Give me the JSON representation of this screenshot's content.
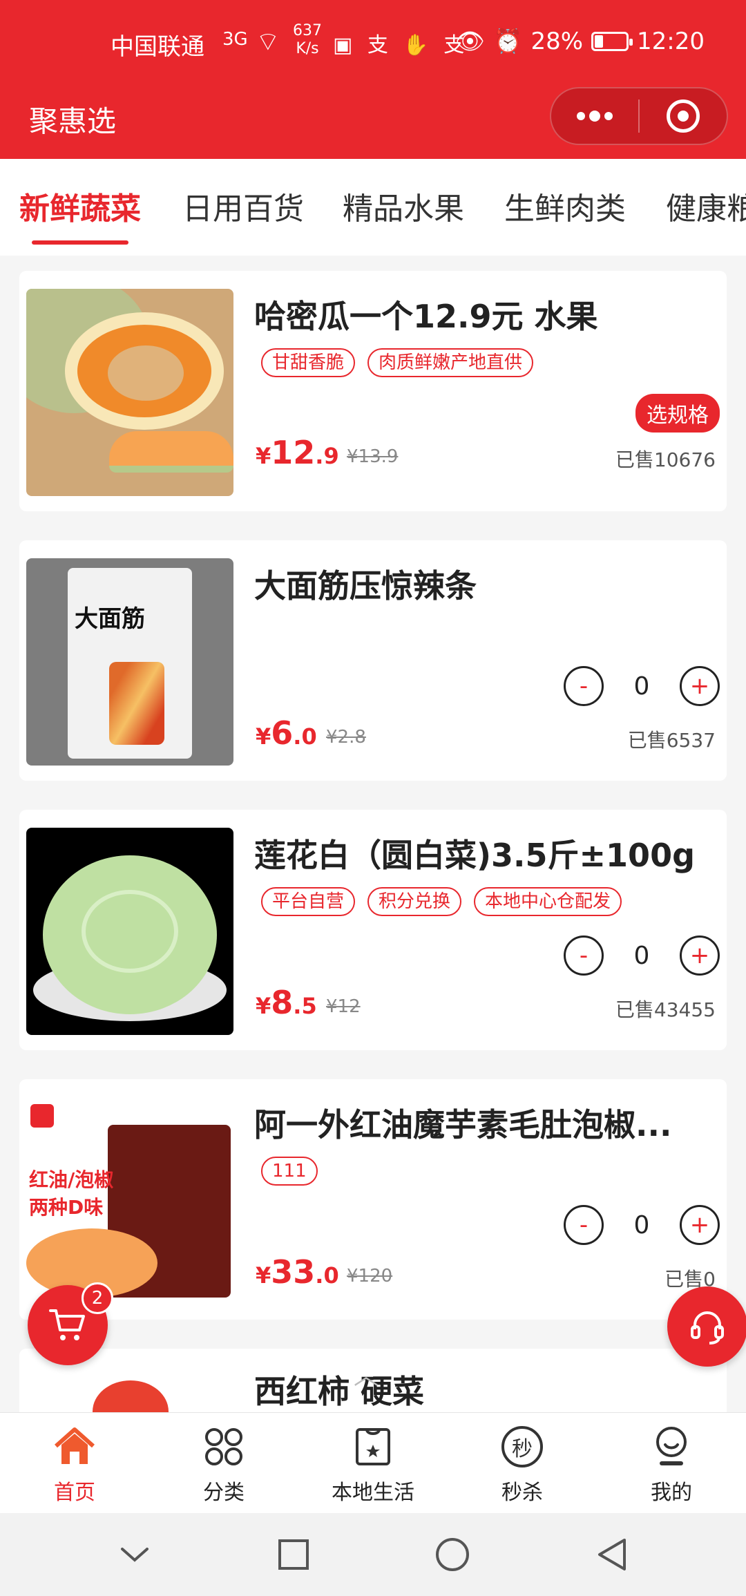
{
  "status_bar": {
    "carrier": "中国联通",
    "signal": "3G",
    "net_speed_value": "637",
    "net_speed_unit": "K/s",
    "battery": "28%",
    "battery_level": 0.28,
    "time": "12:20"
  },
  "header": {
    "title": "聚惠选",
    "menu_icon": "more-dots-icon",
    "close_icon": "target-close-icon"
  },
  "tabs": [
    {
      "label": "新鲜蔬菜",
      "active": true
    },
    {
      "label": "日用百货"
    },
    {
      "label": "精品水果"
    },
    {
      "label": "生鲜肉类"
    },
    {
      "label": "健康粮"
    }
  ],
  "products": [
    {
      "name": "哈密瓜一个12.9元 水果",
      "tags": [
        "甘甜香脆",
        "肉质鲜嫩产地直供"
      ],
      "price_symbol": "¥",
      "price_int": "12",
      "price_dec": ".9",
      "original_price": "¥13.9",
      "sold": "已售10676",
      "spec_button": "选规格"
    },
    {
      "name": "大面筋压惊辣条",
      "tags": [],
      "price_symbol": "¥",
      "price_int": "6",
      "price_dec": ".0",
      "original_price": "¥2.8",
      "sold": "已售6537",
      "qty": "0",
      "thumb_text": "大面筋"
    },
    {
      "name": "莲花白（圆白菜)3.5斤±100g",
      "tags": [
        "平台自营",
        "积分兑换",
        "本地中心仓配发"
      ],
      "price_symbol": "¥",
      "price_int": "8",
      "price_dec": ".5",
      "original_price": "¥12",
      "sold": "已售43455",
      "qty": "0"
    },
    {
      "name": "阿一外红油魔芋素毛肚泡椒...",
      "tags": [
        "111"
      ],
      "price_symbol": "¥",
      "price_int": "33",
      "price_dec": ".0",
      "original_price": "¥120",
      "sold": "已售0",
      "qty": "0",
      "thumb_text_1": "红油/泡椒",
      "thumb_text_2": "两种D味"
    },
    {
      "name": "西红柿 硬菜"
    }
  ],
  "stepper": {
    "minus": "-",
    "plus": "+"
  },
  "cart": {
    "badge": "2",
    "icon": "cart-icon"
  },
  "service_icon": "headset-icon",
  "back_to_top_icon": "chevron-up-icon",
  "bottom_nav": [
    {
      "label": "首页",
      "icon": "home-icon",
      "active": true
    },
    {
      "label": "分类",
      "icon": "category-icon"
    },
    {
      "label": "本地生活",
      "icon": "local-life-icon"
    },
    {
      "label": "秒杀",
      "icon": "flash-sale-icon",
      "icon_text": "秒"
    },
    {
      "label": "我的",
      "icon": "profile-icon"
    }
  ],
  "colors": {
    "accent": "#e8272d",
    "text": "#222222",
    "muted": "#888888"
  }
}
